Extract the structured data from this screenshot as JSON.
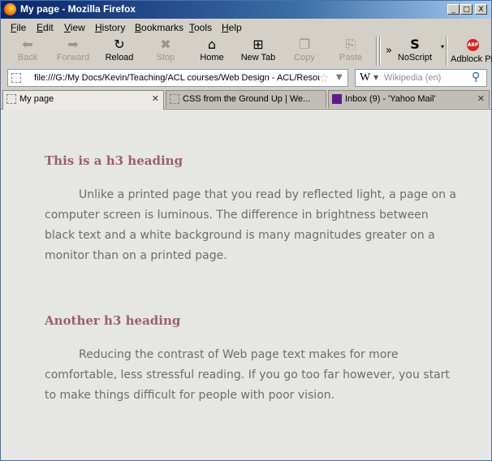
{
  "window": {
    "title": "My page - Mozilla Firefox",
    "controls": {
      "minimize": "_",
      "maximize": "□",
      "close": "X"
    }
  },
  "menu": [
    "File",
    "Edit",
    "View",
    "History",
    "Bookmarks",
    "Tools",
    "Help"
  ],
  "navbar": {
    "back": "Back",
    "forward": "Forward",
    "reload": "Reload",
    "stop": "Stop",
    "home": "Home",
    "new_tab": "New Tab",
    "copy": "Copy",
    "paste": "Paste",
    "overflow": "»",
    "noscript": "NoScript",
    "adblock": "Adblock Pl"
  },
  "address": {
    "url": "file:///G:/My Docs/Kevin/Teaching/ACL courses/Web Design - ACL/Resources/"
  },
  "search": {
    "engine": "W",
    "placeholder": "Wikipedia (en)"
  },
  "tabs": [
    {
      "label": "My page",
      "active": true
    },
    {
      "label": "CSS from the Ground Up | We...",
      "active": false
    },
    {
      "label": "Inbox (9) - 'Yahoo Mail'",
      "active": false
    }
  ],
  "content": {
    "section1": {
      "heading": "This is a h3 heading",
      "paragraph": "Unlike a printed page that you read by reflected light, a page on a computer screen is luminous. The difference in brightness between black text and a white background is many magnitudes greater on a monitor than on a printed page."
    },
    "section2": {
      "heading": "Another h3 heading",
      "paragraph": "Reducing the contrast of Web page text makes for more comfortable, less stressful reading. If you go too far however, you start to make things difficult for people with poor vision."
    }
  },
  "colors": {
    "heading": "#9a6070",
    "body_text": "#6d6d6d",
    "page_bg": "#e6e6e4",
    "chrome": "#d4d0c8",
    "title_bar": "#0a246a"
  }
}
